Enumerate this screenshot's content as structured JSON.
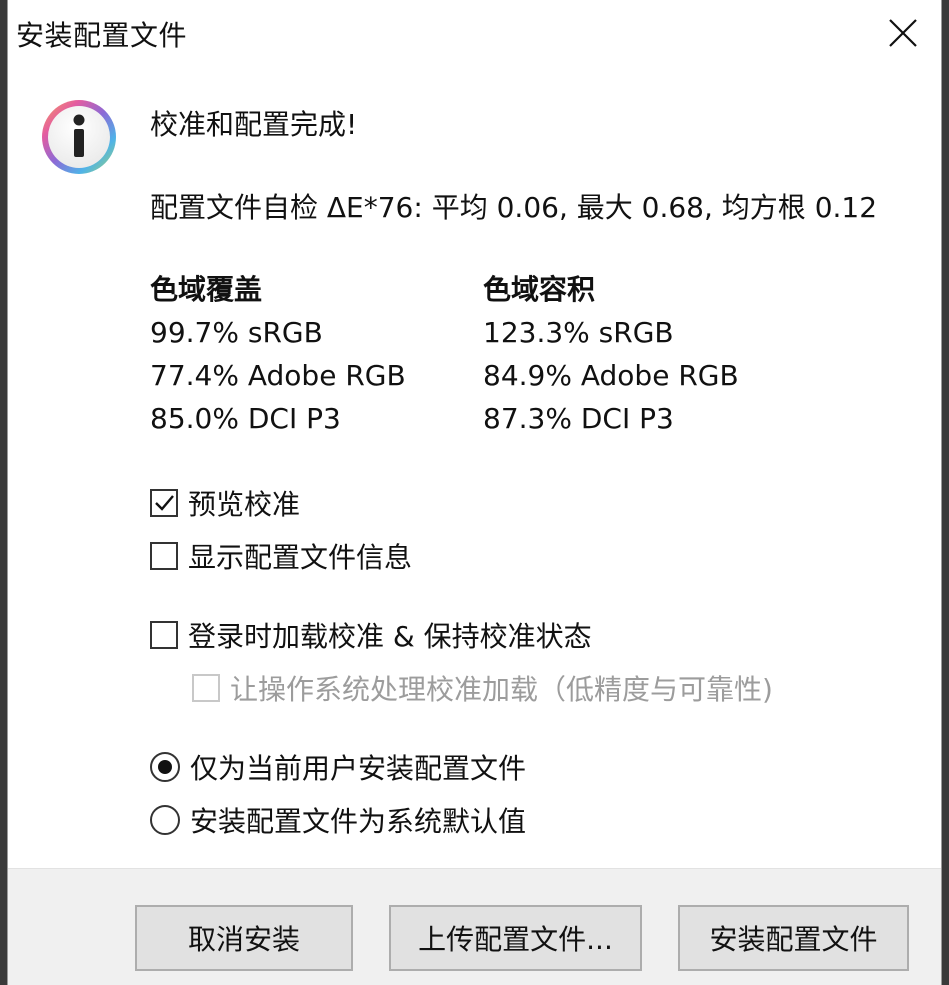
{
  "window": {
    "title": "安装配置文件",
    "close_icon": "close-icon"
  },
  "dialog": {
    "icon": "info-icon",
    "heading": "校准和配置完成!",
    "self_check": "配置文件自检 ΔE*76: 平均 0.06, 最大 0.68, 均方根 0.12"
  },
  "gamut": {
    "coverage": {
      "title": "色域覆盖",
      "items": [
        "99.7% sRGB",
        "77.4% Adobe RGB",
        "85.0% DCI P3"
      ]
    },
    "volume": {
      "title": "色域容积",
      "items": [
        "123.3% sRGB",
        "84.9% Adobe RGB",
        "87.3% DCI P3"
      ]
    }
  },
  "options": {
    "preview_calibration": {
      "label": "预览校准",
      "checked": true
    },
    "show_profile_info": {
      "label": "显示配置文件信息",
      "checked": false
    },
    "load_on_login": {
      "label": "登录时加载校准 & 保持校准状态",
      "checked": false
    },
    "os_handles_loading": {
      "label": "让操作系统处理校准加载（低精度与可靠性)",
      "checked": false,
      "disabled": true
    }
  },
  "install_scope": {
    "selected": "current_user",
    "options": {
      "current_user": "仅为当前用户安装配置文件",
      "system_default": "安装配置文件为系统默认值"
    }
  },
  "buttons": {
    "cancel": "取消安装",
    "upload": "上传配置文件...",
    "install": "安装配置文件"
  }
}
